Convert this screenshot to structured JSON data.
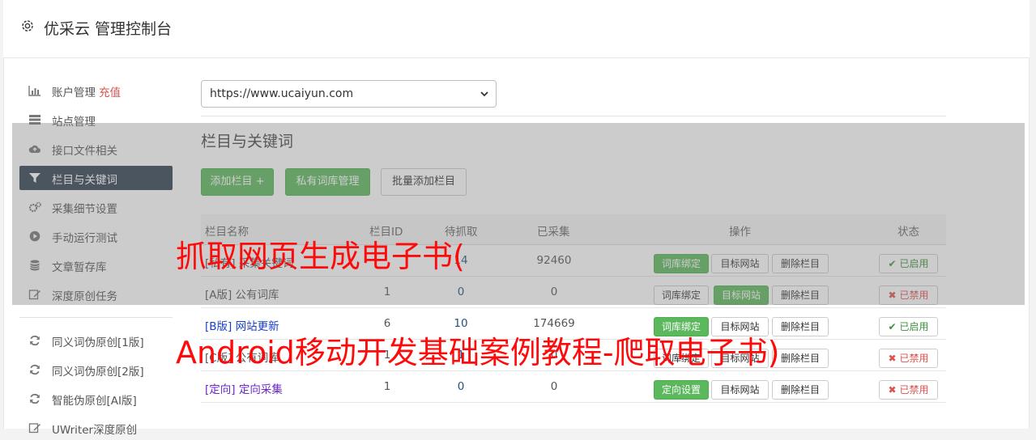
{
  "header": {
    "title": "优采云 管理控制台",
    "icon": "gear-icon"
  },
  "sidebar": {
    "items": [
      {
        "label": "账户管理",
        "extra": "充值",
        "icon": "bar-chart-icon"
      },
      {
        "label": "站点管理",
        "icon": "list-icon"
      },
      {
        "label": "接口文件相关",
        "icon": "cloud-upload-icon"
      },
      {
        "label": "栏目与关键词",
        "icon": "filter-icon",
        "active": true
      },
      {
        "label": "采集细节设置",
        "icon": "gears-icon"
      },
      {
        "label": "手动运行测试",
        "icon": "play-circle-icon"
      },
      {
        "label": "文章暂存库",
        "icon": "database-icon"
      },
      {
        "label": "深度原创任务",
        "icon": "edit-icon"
      },
      {
        "label": "同义词伪原创[1版]",
        "icon": "refresh-icon"
      },
      {
        "label": "同义词伪原创[2版]",
        "icon": "refresh-icon"
      },
      {
        "label": "智能伪原创[AI版]",
        "icon": "refresh-icon"
      },
      {
        "label": "UWriter深度原创",
        "icon": "edit-icon"
      }
    ]
  },
  "site_select": {
    "value": "https://www.ucaiyun.com"
  },
  "section_title": "栏目与关键词",
  "toolbar": {
    "add_column": "添加栏目 +",
    "private_lexicon": "私有词库管理",
    "batch_add": "批量添加栏目"
  },
  "table": {
    "headers": [
      "栏目名称",
      "栏目ID",
      "待抓取",
      "已采集",
      "操作",
      "状态"
    ],
    "rows": [
      {
        "name": "[私有] 采集关键词",
        "id": "",
        "pending": "14",
        "collected": "92460",
        "actions": [
          "词库绑定",
          "目标网站",
          "删除栏目"
        ],
        "status": "已启用"
      },
      {
        "name": "[A版] 公有词库",
        "id": "1",
        "pending": "0",
        "collected": "0",
        "actions": [
          "词库绑定",
          "目标网站",
          "删除栏目"
        ],
        "status": "已禁用"
      },
      {
        "name": "[B版] 网站更新",
        "id": "6",
        "pending": "10",
        "collected": "174669",
        "actions": [
          "词库绑定",
          "目标网站",
          "删除栏目"
        ],
        "status": "已启用"
      },
      {
        "name": "[C版] 公有词库",
        "id": "1",
        "pending": "1",
        "collected": "0",
        "actions": [
          "词库绑定",
          "目标网站",
          "删除栏目"
        ],
        "status": "已禁用"
      },
      {
        "name": "[定向] 定向采集",
        "id": "1",
        "pending": "0",
        "collected": "0",
        "actions": [
          "定向设置",
          "目标网站",
          "删除栏目"
        ],
        "status": "已禁用"
      }
    ]
  },
  "watermark": {
    "line1": "抓取网页生成电子书(",
    "line2": "Android移动开发基础案例教程-爬取电子书)"
  },
  "colors": {
    "sidebar_active": "#2f4050",
    "primary_green": "#5cb85c",
    "danger_red": "#d9534f",
    "watermark_red": "#ff0a0a"
  }
}
